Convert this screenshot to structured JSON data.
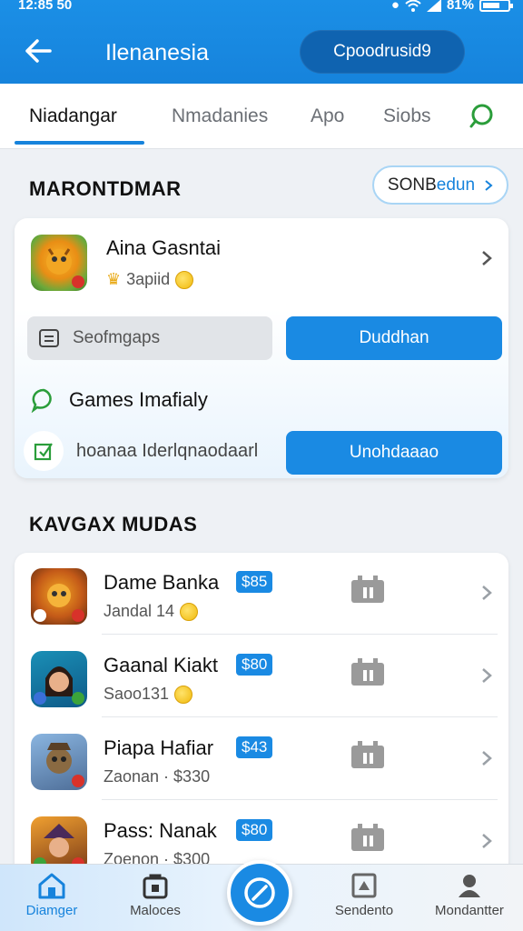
{
  "status_bar": {
    "time": "12:85 50",
    "battery": "81%"
  },
  "header": {
    "title": "Ilenanesia",
    "action_label": "Cpoodrusid9"
  },
  "tabs": [
    {
      "label": "Niadangar",
      "active": true
    },
    {
      "label": "Nmadanies",
      "active": false
    },
    {
      "label": "Apo",
      "active": false
    },
    {
      "label": "Siobs",
      "active": false
    }
  ],
  "section1": {
    "title": "MARONTDMAR",
    "pill_left": "SONB",
    "pill_right": "edun"
  },
  "featured": {
    "name": "Aina Gasntai",
    "sub": "3apiid",
    "grey_button": "Seofmgaps",
    "blue_button": "Duddhan",
    "feature1": "Games Imafialy",
    "feature2": "hoanaa Iderlqnaodaarl",
    "blue_button2": "Unohdaaao"
  },
  "section2": {
    "title": "KAVGAX MUDAS"
  },
  "list": [
    {
      "name": "Dame Banka",
      "price": "$85",
      "sub": "Jandal 14"
    },
    {
      "name": "Gaanal Kiakt",
      "price": "$80",
      "sub": "Saoo131"
    },
    {
      "name": "Piapa Hafiar",
      "price": "$43",
      "sub": "Zaonan · $330"
    },
    {
      "name": "Pass: Nanak",
      "price": "$80",
      "sub": "Zoenon · $300"
    }
  ],
  "bottom_nav": [
    {
      "label": "Diamger",
      "active": true
    },
    {
      "label": "Maloces",
      "active": false
    },
    {
      "label": "Sendento",
      "active": false
    },
    {
      "label": "Mondantter",
      "active": false
    }
  ],
  "colors": {
    "primary": "#1683dc",
    "header": "#1b8fe6",
    "button": "#1a8ae3"
  }
}
